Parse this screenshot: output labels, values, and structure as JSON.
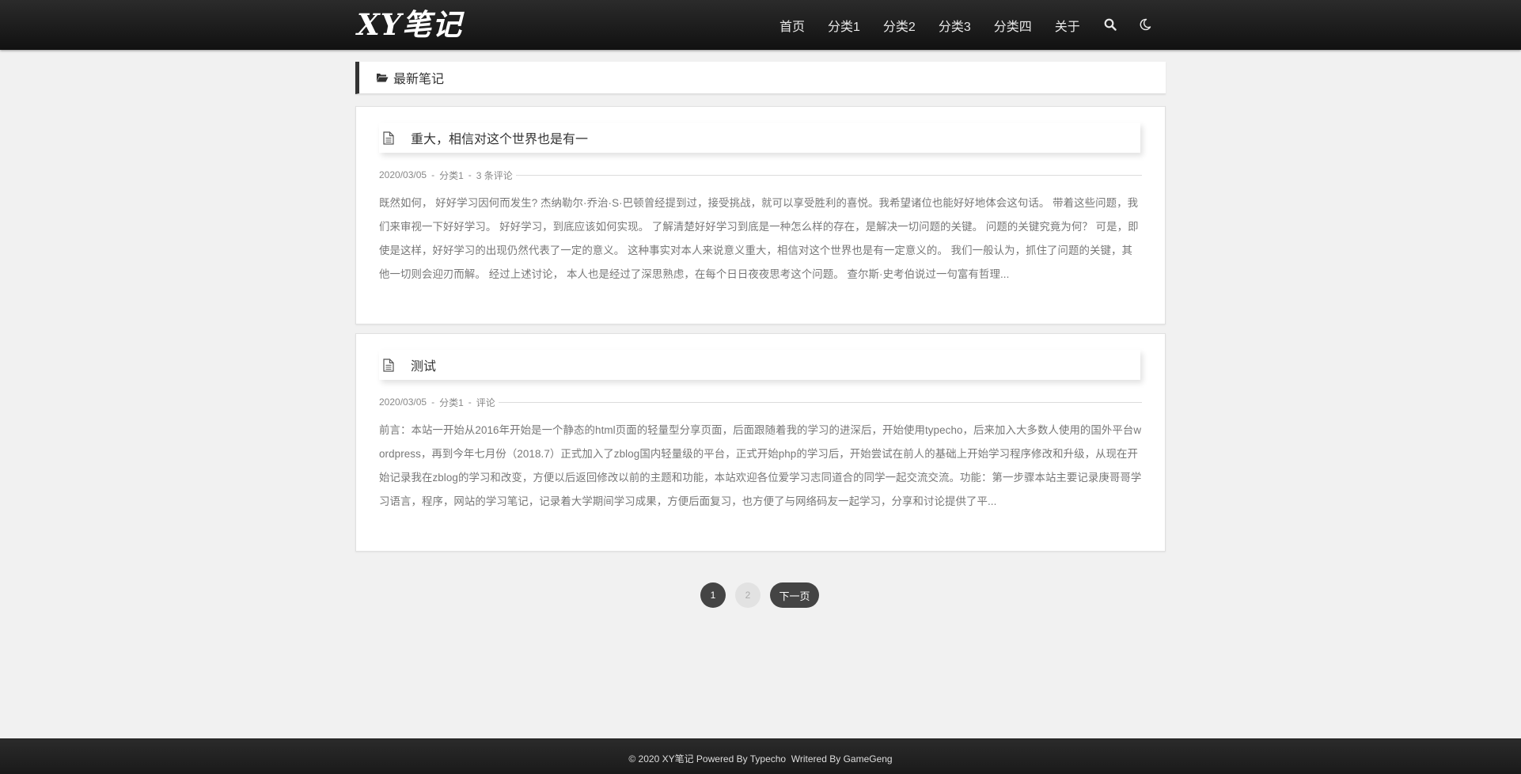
{
  "site": {
    "logo": "XY笔记"
  },
  "nav": {
    "items": [
      "首页",
      "分类1",
      "分类2",
      "分类3",
      "分类四",
      "关于"
    ],
    "search_icon": "search-icon",
    "theme_icon": "moon-icon"
  },
  "section": {
    "title": "最新笔记",
    "icon": "folder-open-icon"
  },
  "posts": [
    {
      "title": "重大，相信对这个世界也是有一",
      "date": "2020/03/05",
      "category": "分类1",
      "comments": "3 条评论",
      "excerpt": "既然如何，  好好学习因何而发生?  杰纳勒尔·乔治·S·巴顿曾经提到过，接受挑战，就可以享受胜利的喜悦。我希望诸位也能好好地体会这句话。  带着这些问题，我们来审视一下好好学习。  好好学习，到底应该如何实现。  了解清楚好好学习到底是一种怎么样的存在，是解决一切问题的关键。  问题的关键究竟为何？  可是，即使是这样，好好学习的出现仍然代表了一定的意义。  这种事实对本人来说意义重大，相信对这个世界也是有一定意义的。  我们一般认为，抓住了问题的关键，其他一切则会迎刃而解。  经过上述讨论，  本人也是经过了深思熟虑，在每个日日夜夜思考这个问题。        查尔斯·史考伯说过一句富有哲理..."
    },
    {
      "title": "测试",
      "date": "2020/03/05",
      "category": "分类1",
      "comments": "评论",
      "excerpt": "前言：本站一开始从2016年开始是一个静态的html页面的轻量型分享页面，后面跟随着我的学习的进深后，开始使用typecho，后来加入大多数人使用的国外平台wordpress，再到今年七月份（2018.7）正式加入了zblog国内轻量级的平台，正式开始php的学习后，开始尝试在前人的基础上开始学习程序修改和升级，从现在开始记录我在zblog的学习和改变，方便以后返回修改以前的主题和功能，本站欢迎各位爱学习志同道合的同学一起交流交流。功能：第一步骤本站主要记录庚哥哥学习语言，程序，网站的学习笔记，记录着大学期间学习成果，方便后面复习，也方便了与网络码友一起学习，分享和讨论提供了平..."
    }
  ],
  "pagination": {
    "pages": [
      "1",
      "2"
    ],
    "current": "1",
    "next_label": "下一页"
  },
  "footer": {
    "text": "© 2020 XY笔记 Powered By Typecho  Writered By GameGeng"
  }
}
